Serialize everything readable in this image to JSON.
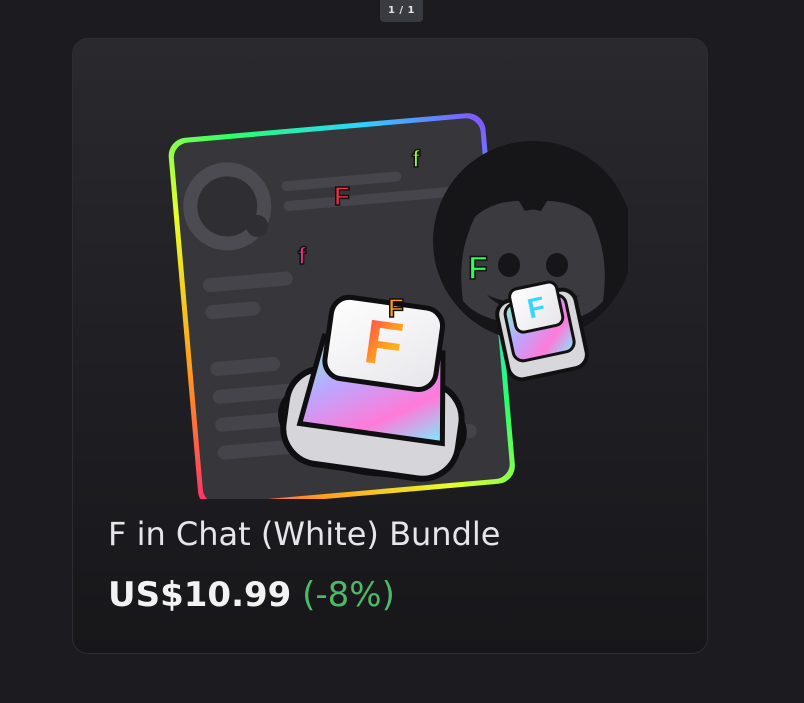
{
  "pager": {
    "label": "1 / 1"
  },
  "product": {
    "title": "F in Chat (White) Bundle",
    "price": "US$10.99",
    "discount": "(-8%)"
  },
  "artwork": {
    "letters": [
      "f",
      "F",
      "F",
      "F",
      "f",
      "F",
      "F"
    ]
  },
  "colors": {
    "background": "#1c1c20",
    "card": "#222226",
    "discount": "#4fb866",
    "discord_icon": "#3a3a3f"
  }
}
